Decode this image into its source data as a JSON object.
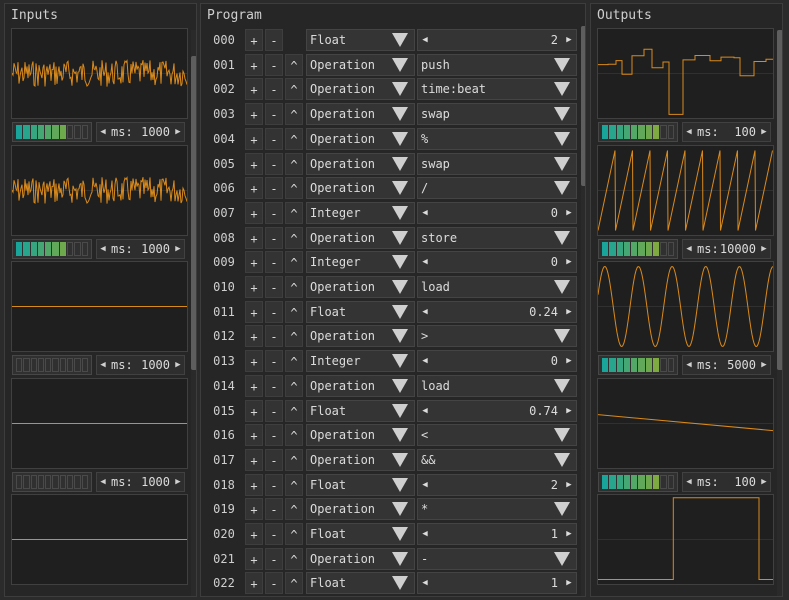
{
  "panels": {
    "inputs_title": "Inputs",
    "program_title": "Program",
    "outputs_title": "Outputs"
  },
  "colors": {
    "trace": "#d98a1c",
    "meter_from": "#1aa59a",
    "meter_to": "#9aab28"
  },
  "controls": {
    "ms_label": "ms:",
    "arrow_left": "◀",
    "arrow_right": "▶",
    "row_plus": "+",
    "row_minus": "-",
    "row_up": "^"
  },
  "inputs": [
    {
      "ms": "1000",
      "level": 7,
      "wave": "noise",
      "offset": 0.5
    },
    {
      "ms": "1000",
      "level": 7,
      "wave": "noise",
      "offset": 0.5
    },
    {
      "ms": "1000",
      "level": 0,
      "wave": "flat",
      "offset": 0.5
    },
    {
      "ms": "1000",
      "level": 0,
      "wave": "flat",
      "offset": 0.5
    },
    {
      "wave": "flat",
      "offset": 0.5
    }
  ],
  "outputs": [
    {
      "ms": "100",
      "level": 8,
      "wave": "steps"
    },
    {
      "ms": "10000",
      "level": 8,
      "wave": "saw"
    },
    {
      "ms": "5000",
      "level": 8,
      "wave": "sine"
    },
    {
      "ms": "100",
      "level": 8,
      "wave": "ramp"
    },
    {
      "wave": "pulse"
    }
  ],
  "program": [
    {
      "idx": "000",
      "type": "Float",
      "kind": "num",
      "value": "2",
      "up": false
    },
    {
      "idx": "001",
      "type": "Operation",
      "kind": "sel",
      "value": "push"
    },
    {
      "idx": "002",
      "type": "Operation",
      "kind": "sel",
      "value": "time:beat"
    },
    {
      "idx": "003",
      "type": "Operation",
      "kind": "sel",
      "value": "swap"
    },
    {
      "idx": "004",
      "type": "Operation",
      "kind": "sel",
      "value": "%"
    },
    {
      "idx": "005",
      "type": "Operation",
      "kind": "sel",
      "value": "swap"
    },
    {
      "idx": "006",
      "type": "Operation",
      "kind": "sel",
      "value": "/"
    },
    {
      "idx": "007",
      "type": "Integer",
      "kind": "num",
      "value": "0"
    },
    {
      "idx": "008",
      "type": "Operation",
      "kind": "sel",
      "value": "store"
    },
    {
      "idx": "009",
      "type": "Integer",
      "kind": "num",
      "value": "0"
    },
    {
      "idx": "010",
      "type": "Operation",
      "kind": "sel",
      "value": "load"
    },
    {
      "idx": "011",
      "type": "Float",
      "kind": "num",
      "value": "0.24"
    },
    {
      "idx": "012",
      "type": "Operation",
      "kind": "sel",
      "value": ">"
    },
    {
      "idx": "013",
      "type": "Integer",
      "kind": "num",
      "value": "0"
    },
    {
      "idx": "014",
      "type": "Operation",
      "kind": "sel",
      "value": "load"
    },
    {
      "idx": "015",
      "type": "Float",
      "kind": "num",
      "value": "0.74"
    },
    {
      "idx": "016",
      "type": "Operation",
      "kind": "sel",
      "value": "<"
    },
    {
      "idx": "017",
      "type": "Operation",
      "kind": "sel",
      "value": "&&"
    },
    {
      "idx": "018",
      "type": "Float",
      "kind": "num",
      "value": "2"
    },
    {
      "idx": "019",
      "type": "Operation",
      "kind": "sel",
      "value": "*"
    },
    {
      "idx": "020",
      "type": "Float",
      "kind": "num",
      "value": "1"
    },
    {
      "idx": "021",
      "type": "Operation",
      "kind": "sel",
      "value": "-"
    },
    {
      "idx": "022",
      "type": "Float",
      "kind": "num",
      "value": "1"
    }
  ]
}
